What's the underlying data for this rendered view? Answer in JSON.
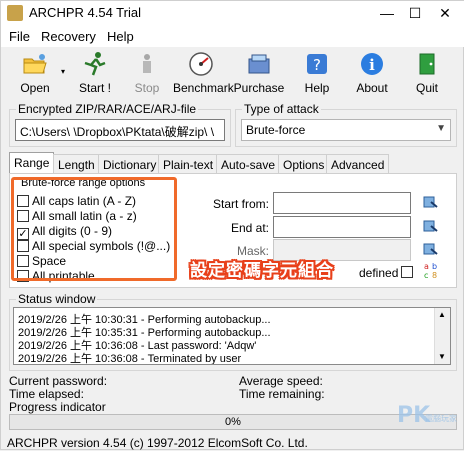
{
  "window": {
    "title": "ARCHPR 4.54 Trial",
    "min": "—",
    "max": "☐",
    "close": "✕"
  },
  "menu": [
    "File",
    "Recovery",
    "Help"
  ],
  "toolbar": [
    {
      "label": "Open",
      "icon": "open-folder-icon",
      "disabled": false
    },
    {
      "label": "Start !",
      "icon": "start-runner-icon",
      "disabled": false
    },
    {
      "label": "Stop",
      "icon": "stop-icon",
      "disabled": true
    },
    {
      "label": "Benchmark",
      "icon": "benchmark-icon",
      "disabled": false
    },
    {
      "label": "Purchase",
      "icon": "purchase-icon",
      "disabled": false
    },
    {
      "label": "Help",
      "icon": "help-icon",
      "disabled": false
    },
    {
      "label": "About",
      "icon": "about-icon",
      "disabled": false
    },
    {
      "label": "Quit",
      "icon": "quit-door-icon",
      "disabled": false
    }
  ],
  "encrypted": {
    "label": "Encrypted ZIP/RAR/ACE/ARJ-file",
    "value": "C:\\Users\\ \\Dropbox\\PKtata\\破解zip\\  \\"
  },
  "attack": {
    "label": "Type of attack",
    "value": "Brute-force"
  },
  "tabs": [
    "Range",
    "Length",
    "Dictionary",
    "Plain-text",
    "Auto-save",
    "Options",
    "Advanced"
  ],
  "range": {
    "group_label": "Brute-force range options",
    "options": [
      {
        "label": "All caps latin (A - Z)",
        "checked": false
      },
      {
        "label": "All small latin (a - z)",
        "checked": false
      },
      {
        "label": "All digits (0 - 9)",
        "checked": true
      },
      {
        "label": "All special symbols (!@...)",
        "checked": false
      },
      {
        "label": "Space",
        "checked": false
      },
      {
        "label": "All printable",
        "checked": false
      }
    ],
    "start_from_label": "Start from:",
    "end_at_label": "End at:",
    "mask_label": "Mask:",
    "user_defined_label": "defined"
  },
  "overlay": "設定密碼字元組合",
  "status": {
    "label": "Status window",
    "lines": [
      "2019/2/26 上午 10:30:31 - Performing autobackup...",
      "2019/2/26 上午 10:35:31 - Performing autobackup...",
      "2019/2/26 上午 10:36:08 - Last password: 'Adqw'",
      "2019/2/26 上午 10:36:08 - Terminated by user"
    ]
  },
  "info": {
    "current_password": "Current password:",
    "time_elapsed": "Time elapsed:",
    "progress_indicator": "Progress indicator",
    "average_speed": "Average speed:",
    "time_remaining": "Time remaining:"
  },
  "progress": {
    "value": 0,
    "text": "0%"
  },
  "statusbar": "ARCHPR version 4.54 (c) 1997-2012 ElcomSoft Co. Ltd.",
  "watermark": {
    "logo": "PK",
    "sub": "電腦玩家"
  },
  "colors": {
    "highlight": "#f06a2a",
    "overlay_text": "#e8401a"
  }
}
